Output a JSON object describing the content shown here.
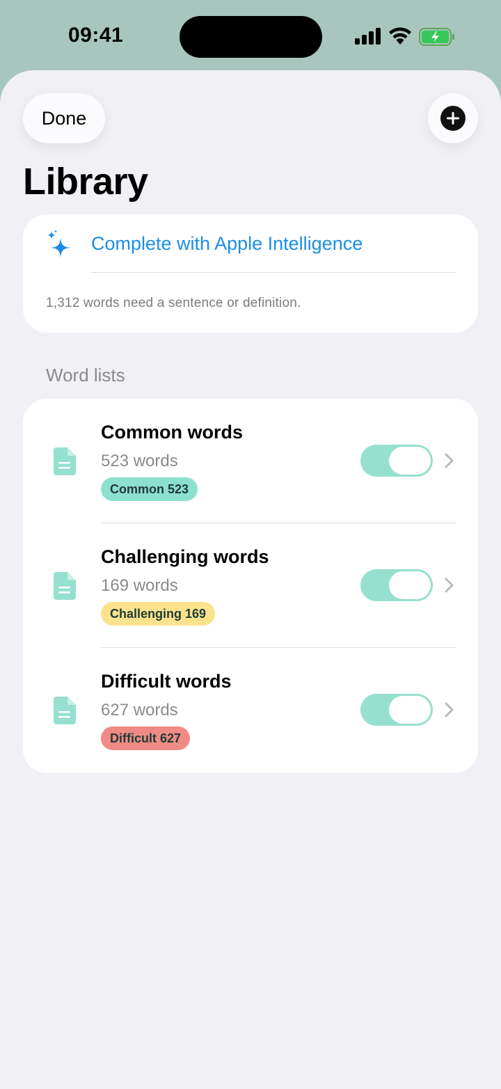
{
  "status_bar": {
    "time": "09:41",
    "signal_icon": "cellular-signal-icon",
    "wifi_icon": "wifi-icon",
    "battery_icon": "battery-charging-icon"
  },
  "header": {
    "done_label": "Done",
    "add_icon": "plus-circle-icon",
    "title": "Library"
  },
  "ai_card": {
    "icon": "sparkles-icon",
    "link_label": "Complete with Apple Intelligence",
    "note": "1,312 words need a sentence or definition."
  },
  "word_lists": {
    "section_title": "Word lists",
    "items": [
      {
        "icon": "document-icon",
        "title": "Common words",
        "subtitle": "523 words",
        "badge": "Common 523",
        "badge_color": "#8de0ce",
        "enabled": true
      },
      {
        "icon": "document-icon",
        "title": "Challenging words",
        "subtitle": "169 words",
        "badge": "Challenging 169",
        "badge_color": "#fbe28d",
        "enabled": true
      },
      {
        "icon": "document-icon",
        "title": "Difficult words",
        "subtitle": "627 words",
        "badge": "Difficult 627",
        "badge_color": "#f08a85",
        "enabled": true
      }
    ]
  },
  "colors": {
    "accent_blue": "#1a8ee6",
    "toggle_on": "#96e0cf",
    "doc_icon": "#96e0cf",
    "status_bg": "#a8c6bd",
    "sheet_bg": "#f0f0f5"
  }
}
